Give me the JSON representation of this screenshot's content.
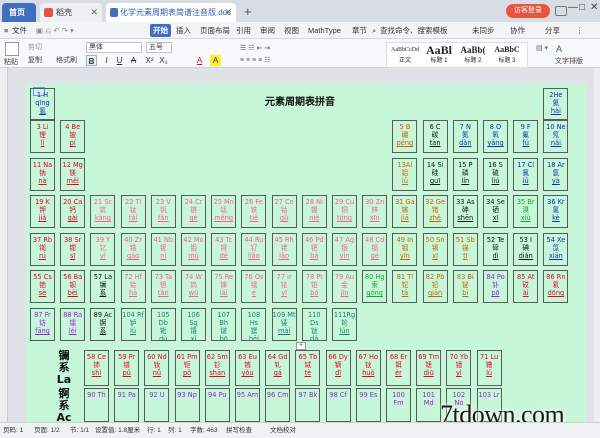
{
  "tabs": {
    "home": "首页",
    "wps": "稻壳",
    "doc": "化学元素周期表简谱注音版.doc"
  },
  "window": {
    "guest": "访客登录",
    "add_tab": "+",
    "minimize": "—",
    "maximize": "□",
    "close": "✕"
  },
  "ribbon_tabs": [
    "文件",
    "开始",
    "插入",
    "页面布局",
    "引用",
    "审阅",
    "视图",
    "MathType",
    "章节"
  ],
  "ribbon_right": {
    "search": "查找命令、搜索模板",
    "unsync": "未同步",
    "collab": "协作",
    "share": "分享"
  },
  "toolbar": {
    "paste": "粘贴",
    "cut": "剪切",
    "copy": "复制",
    "format_painter": "格式刷",
    "font": "黑体",
    "size": "五号",
    "style_text": "文字排版",
    "bold": "B",
    "italic": "I",
    "underline": "U",
    "strike": "A",
    "superscript": "X²",
    "subscript": "X₂",
    "font_color": "A",
    "highlight": "A"
  },
  "styles": [
    {
      "preview": "AaBbCcDd",
      "name": "正文"
    },
    {
      "preview": "AaBl",
      "name": "标题 1"
    },
    {
      "preview": "AaBb(",
      "name": "标题 2"
    },
    {
      "preview": "AaBbC",
      "name": "标题 3"
    }
  ],
  "doc": {
    "title": "元素周期表拼音"
  },
  "elements": [
    {
      "id": "h",
      "l1": "1 H",
      "l2": "qīng",
      "l3": "氢",
      "color": "c-blue"
    },
    {
      "id": "he",
      "l1": "2He",
      "l2": "氦",
      "l3": "hài",
      "color": "c-blue"
    },
    {
      "id": "li",
      "l1": "3 Li",
      "l2": "锂",
      "l3": "lǐ",
      "color": "c-red"
    },
    {
      "id": "be",
      "l1": "4 Be",
      "l2": "铍",
      "l3": "pí",
      "color": "c-red"
    },
    {
      "id": "b",
      "l1": "5 B",
      "l2": "硼",
      "l3": "péng",
      "color": "c-orange"
    },
    {
      "id": "c",
      "l1": "6 C",
      "l2": "碳",
      "l3": "tàn",
      "color": "c-black"
    },
    {
      "id": "n",
      "l1": "7 N",
      "l2": "氮",
      "l3": "dàn",
      "color": "c-blue"
    },
    {
      "id": "o",
      "l1": "8 O",
      "l2": "氧",
      "l3": "yǎng",
      "color": "c-blue"
    },
    {
      "id": "f",
      "l1": "9 F",
      "l2": "氟",
      "l3": "fú",
      "color": "c-blue"
    },
    {
      "id": "ne",
      "l1": "10 Ne",
      "l2": "氖",
      "l3": "nǎi",
      "color": "c-blue"
    },
    {
      "id": "na",
      "l1": "11 Na",
      "l2": "钠",
      "l3": "nà",
      "color": "c-red"
    },
    {
      "id": "mg",
      "l1": "12 Mg",
      "l2": "镁",
      "l3": "měi",
      "color": "c-red"
    },
    {
      "id": "al",
      "l1": "13Al",
      "l2": "铝",
      "l3": "lǚ",
      "color": "c-orange"
    },
    {
      "id": "si",
      "l1": "14 Si",
      "l2": "硅",
      "l3": "guī",
      "color": "c-black"
    },
    {
      "id": "p",
      "l1": "15 P",
      "l2": "磷",
      "l3": "lín",
      "color": "c-black"
    },
    {
      "id": "s",
      "l1": "16 S",
      "l2": "硫",
      "l3": "liú",
      "color": "c-black"
    },
    {
      "id": "cl",
      "l1": "17 Cl",
      "l2": "氯",
      "l3": "lǜ",
      "color": "c-blue"
    },
    {
      "id": "ar",
      "l1": "18 Ar",
      "l2": "氩",
      "l3": "yà",
      "color": "c-blue"
    },
    {
      "id": "k",
      "l1": "19 K",
      "l2": "钾",
      "l3": "jiǎ",
      "color": "c-red"
    },
    {
      "id": "ca",
      "l1": "20 Ca",
      "l2": "钙",
      "l3": "gài",
      "color": "c-red"
    },
    {
      "id": "sc",
      "l1": "21 Sc",
      "l2": "钪",
      "l3": "kàng",
      "color": "c-pink"
    },
    {
      "id": "ti",
      "l1": "22 Ti",
      "l2": "钛",
      "l3": "tài",
      "color": "c-pink"
    },
    {
      "id": "v",
      "l1": "23 V",
      "l2": "钒",
      "l3": "fán",
      "color": "c-pink"
    },
    {
      "id": "cr",
      "l1": "24 Cr",
      "l2": "铬",
      "l3": "gè",
      "color": "c-pink"
    },
    {
      "id": "mn",
      "l1": "25 Mn",
      "l2": "锰",
      "l3": "měng",
      "color": "c-pink"
    },
    {
      "id": "fe",
      "l1": "26 Fe",
      "l2": "铁",
      "l3": "tiě",
      "color": "c-pink"
    },
    {
      "id": "co",
      "l1": "27 Co",
      "l2": "钴",
      "l3": "gǔ",
      "color": "c-pink"
    },
    {
      "id": "ni",
      "l1": "28 Ni",
      "l2": "镍",
      "l3": "niè",
      "color": "c-pink"
    },
    {
      "id": "cu",
      "l1": "29 Cu",
      "l2": "铜",
      "l3": "tóng",
      "color": "c-pink"
    },
    {
      "id": "zn",
      "l1": "30 Zn",
      "l2": "锌",
      "l3": "xīn",
      "color": "c-pink"
    },
    {
      "id": "ga",
      "l1": "31 Ga",
      "l2": "镓",
      "l3": "jiā",
      "color": "c-orange"
    },
    {
      "id": "ge",
      "l1": "32 Ge",
      "l2": "锗",
      "l3": "zhě",
      "color": "c-orange"
    },
    {
      "id": "as",
      "l1": "33 As",
      "l2": "砷",
      "l3": "shēn",
      "color": "c-black"
    },
    {
      "id": "se",
      "l1": "34 Se",
      "l2": "硒",
      "l3": "xī",
      "color": "c-black"
    },
    {
      "id": "br",
      "l1": "35 Br",
      "l2": "溴",
      "l3": "xiù",
      "color": "c-green"
    },
    {
      "id": "kr",
      "l1": "36 Kr",
      "l2": "氪",
      "l3": "kè",
      "color": "c-blue"
    },
    {
      "id": "rb",
      "l1": "37 Rb",
      "l2": "铷",
      "l3": "rú",
      "color": "c-red"
    },
    {
      "id": "sr",
      "l1": "38 Sr",
      "l2": "锶",
      "l3": "sī",
      "color": "c-red"
    },
    {
      "id": "y",
      "l1": "39 Y",
      "l2": "钇",
      "l3": "yǐ",
      "color": "c-pink"
    },
    {
      "id": "zr",
      "l1": "40 Zr",
      "l2": "锆",
      "l3": "gào",
      "color": "c-pink"
    },
    {
      "id": "nb",
      "l1": "41 Nb",
      "l2": "铌",
      "l3": "ní",
      "color": "c-pink"
    },
    {
      "id": "mo",
      "l1": "42 Mo",
      "l2": "钼",
      "l3": "mù",
      "color": "c-pink"
    },
    {
      "id": "tc",
      "l1": "43 Tc",
      "l2": "锝",
      "l3": "dé",
      "color": "c-pink"
    },
    {
      "id": "ru",
      "l1": "44 Ru",
      "l2": "钌",
      "l3": "liǎo",
      "color": "c-pink"
    },
    {
      "id": "rh",
      "l1": "45 Rh",
      "l2": "铑",
      "l3": "lǎo",
      "color": "c-pink"
    },
    {
      "id": "pd",
      "l1": "46 Pd",
      "l2": "钯",
      "l3": "bǎ",
      "color": "c-pink"
    },
    {
      "id": "ag",
      "l1": "47 Ag",
      "l2": "银",
      "l3": "yín",
      "color": "c-pink"
    },
    {
      "id": "cd",
      "l1": "48 Cd",
      "l2": "镉",
      "l3": "gé",
      "color": "c-pink"
    },
    {
      "id": "in",
      "l1": "49 In",
      "l2": "铟",
      "l3": "yīn",
      "color": "c-orange"
    },
    {
      "id": "sn",
      "l1": "50 Sn",
      "l2": "锡",
      "l3": "xī",
      "color": "c-orange"
    },
    {
      "id": "sb",
      "l1": "51 Sb",
      "l2": "锑",
      "l3": "tī",
      "color": "c-orange"
    },
    {
      "id": "te",
      "l1": "52 Te",
      "l2": "碲",
      "l3": "dì",
      "color": "c-black"
    },
    {
      "id": "i",
      "l1": "53 I",
      "l2": "碘",
      "l3": "diǎn",
      "color": "c-black"
    },
    {
      "id": "xe",
      "l1": "54 Xe",
      "l2": "氙",
      "l3": "xiān",
      "color": "c-blue"
    },
    {
      "id": "cs",
      "l1": "55 Cs",
      "l2": "铯",
      "l3": "sè",
      "color": "c-red"
    },
    {
      "id": "ba",
      "l1": "56 Ba",
      "l2": "钡",
      "l3": "bèi",
      "color": "c-red"
    },
    {
      "id": "la",
      "l1": "57 La",
      "l2": "镧",
      "l3": "系",
      "color": "c-black"
    },
    {
      "id": "hf",
      "l1": "72 Hf",
      "l2": "铪",
      "l3": "hā",
      "color": "c-pink"
    },
    {
      "id": "ta",
      "l1": "73 Ta",
      "l2": "钽",
      "l3": "tǎn",
      "color": "c-pink"
    },
    {
      "id": "w",
      "l1": "74 W",
      "l2": "钨",
      "l3": "wū",
      "color": "c-pink"
    },
    {
      "id": "re",
      "l1": "75 Re",
      "l2": "铼",
      "l3": "lái",
      "color": "c-pink"
    },
    {
      "id": "os",
      "l1": "76 Os",
      "l2": "锇",
      "l3": "é",
      "color": "c-pink"
    },
    {
      "id": "ir",
      "l1": "77 Ir",
      "l2": "铱",
      "l3": "yī",
      "color": "c-pink"
    },
    {
      "id": "pt",
      "l1": "78 Pt",
      "l2": "铂",
      "l3": "bó",
      "color": "c-pink"
    },
    {
      "id": "au",
      "l1": "79 Au",
      "l2": "金",
      "l3": "jīn",
      "color": "c-pink"
    },
    {
      "id": "hg",
      "l1": "80 Hg",
      "l2": "汞",
      "l3": "gǒng",
      "color": "c-green"
    },
    {
      "id": "tl",
      "l1": "81 Tl",
      "l2": "铊",
      "l3": "tā",
      "color": "c-orange"
    },
    {
      "id": "pb",
      "l1": "82 Pb",
      "l2": "铅",
      "l3": "qiān",
      "color": "c-orange"
    },
    {
      "id": "bi",
      "l1": "83 Bi",
      "l2": "铋",
      "l3": "bì",
      "color": "c-orange"
    },
    {
      "id": "po",
      "l1": "84 Po",
      "l2": "钋",
      "l3": "pō",
      "color": "c-purple"
    },
    {
      "id": "at",
      "l1": "85 At",
      "l2": "砹",
      "l3": "ài",
      "color": "c-red"
    },
    {
      "id": "rn",
      "l1": "86 Rn",
      "l2": "氡",
      "l3": "dōng",
      "color": "c-red"
    },
    {
      "id": "fr",
      "l1": "87 Fr",
      "l2": "钫",
      "l3": "fāng",
      "color": "c-purple"
    },
    {
      "id": "ra",
      "l1": "88 Ra",
      "l2": "镭",
      "l3": "léi",
      "color": "c-purple"
    },
    {
      "id": "ac",
      "l1": "89 Ac",
      "l2": "锕",
      "l3": "系",
      "color": "c-black"
    },
    {
      "id": "rf",
      "l1": "104 Rf",
      "l2": "𬬻",
      "l3": "lú",
      "color": "c-teal"
    },
    {
      "id": "db",
      "l1": "105 Db",
      "l2": "𬭊",
      "l3": "dù",
      "color": "c-teal"
    },
    {
      "id": "sg",
      "l1": "106 Sg",
      "l2": "𬭳",
      "l3": "xǐ",
      "color": "c-teal"
    },
    {
      "id": "bh",
      "l1": "107 Bh",
      "l2": "𬭛",
      "l3": "bō",
      "color": "c-teal"
    },
    {
      "id": "hs",
      "l1": "108 Hs",
      "l2": "𬭶",
      "l3": "hēi",
      "color": "c-teal"
    },
    {
      "id": "mt",
      "l1": "109 Mt",
      "l2": "鿏",
      "l3": "mài",
      "color": "c-teal"
    },
    {
      "id": "ds",
      "l1": "110 Ds",
      "l2": "𫟼",
      "l3": "dá",
      "color": "c-teal"
    },
    {
      "id": "rg",
      "l1": "111Rg",
      "l2": "𬬭",
      "l3": "lún",
      "color": "c-teal"
    }
  ],
  "lanthanides": [
    {
      "l1": "58 Ce",
      "l2": "铈",
      "l3": "shì"
    },
    {
      "l1": "59 Pr",
      "l2": "镨",
      "l3": "pǔ"
    },
    {
      "l1": "60 Nd",
      "l2": "钕",
      "l3": "nǚ"
    },
    {
      "l1": "61 Pm",
      "l2": "钷",
      "l3": "pǒ"
    },
    {
      "l1": "62 Sm",
      "l2": "钐",
      "l3": "shān"
    },
    {
      "l1": "63 Eu",
      "l2": "铕",
      "l3": "yǒu"
    },
    {
      "l1": "64 Gd",
      "l2": "钆",
      "l3": "gá"
    },
    {
      "l1": "65 Tb",
      "l2": "铽",
      "l3": "tè"
    },
    {
      "l1": "66 Dy",
      "l2": "镝",
      "l3": "dī"
    },
    {
      "l1": "67 Ho",
      "l2": "钬",
      "l3": "huǒ"
    },
    {
      "l1": "68 Er",
      "l2": "铒",
      "l3": "ěr"
    },
    {
      "l1": "69 Tm",
      "l2": "铥",
      "l3": "diū"
    },
    {
      "l1": "70 Yb",
      "l2": "镱",
      "l3": "yì"
    },
    {
      "l1": "71 Lu",
      "l2": "镥",
      "l3": "lǔ"
    }
  ],
  "actinides_row": [
    "90 Th",
    "91 Pa",
    "92 U",
    "93 Np",
    "94 Pu",
    "95 Am",
    "96 Cm",
    "97 Bk",
    "98 Cf",
    "99 Es",
    "100 Fm",
    "101 Md",
    "102 No",
    "103 Lr"
  ],
  "series": {
    "la_1": "镧",
    "la_2": "系",
    "la_3": "La",
    "ac_1": "锕",
    "ac_2": "系",
    "ac_3": "Ac"
  },
  "status": {
    "page": "页码: 1",
    "pages": "页面: 1/2",
    "section": "节: 1/1",
    "setting": "设置值: 1.8厘米",
    "row": "行: 1",
    "col": "列: 1",
    "words": "字数: 463",
    "spell": "拼写检查",
    "proof": "文档校对"
  },
  "watermark": "7tdown.com"
}
